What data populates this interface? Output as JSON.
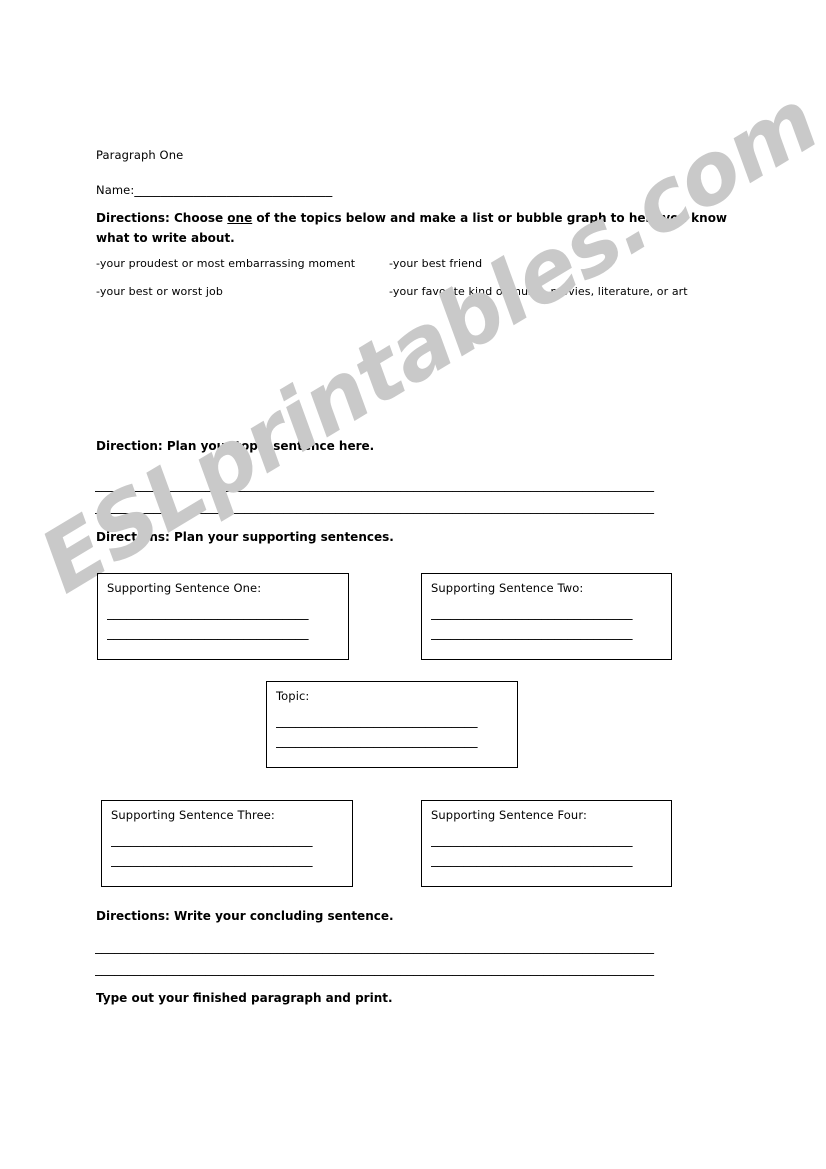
{
  "document": {
    "title": "Paragraph One",
    "name_label": "Name:",
    "name_blank": "______________________________"
  },
  "directions": {
    "choose_topic": {
      "prefix": "Directions: Choose ",
      "emphasis": "one",
      "suffix": " of the topics below and make a list or bubble graph to help you know what to write about."
    },
    "topic_sentence": "Direction: Plan your topic sentence here.",
    "supporting_sentences": "Directions: Plan your supporting sentences.",
    "concluding_sentence": "Directions: Write your concluding sentence.",
    "type_out": "Type out your finished paragraph and print."
  },
  "topics": {
    "column_one": [
      "-your proudest or most embarrassing moment",
      "-your best or worst job"
    ],
    "column_two": [
      "-your best friend",
      "-your favorite kind of music, movies, literature, or art"
    ]
  },
  "blank_lines": {
    "topic_line_1": "______________________________________________________________________________________",
    "topic_line_2": "______________________________________________________________________________________",
    "concluding_line_1": "______________________________________________________________________________________",
    "concluding_line_2": "______________________________________________________________________________________",
    "box_line": "_______________________________"
  },
  "boxes": {
    "supporting_one": {
      "label": "Supporting Sentence One:"
    },
    "supporting_two": {
      "label": "Supporting Sentence Two:"
    },
    "topic": {
      "label": "Topic:"
    },
    "supporting_three": {
      "label": "Supporting Sentence Three:"
    },
    "supporting_four": {
      "label": "Supporting Sentence Four:"
    }
  },
  "watermark": {
    "text": "ESLprintables.com",
    "color": "#c9c9c9"
  }
}
